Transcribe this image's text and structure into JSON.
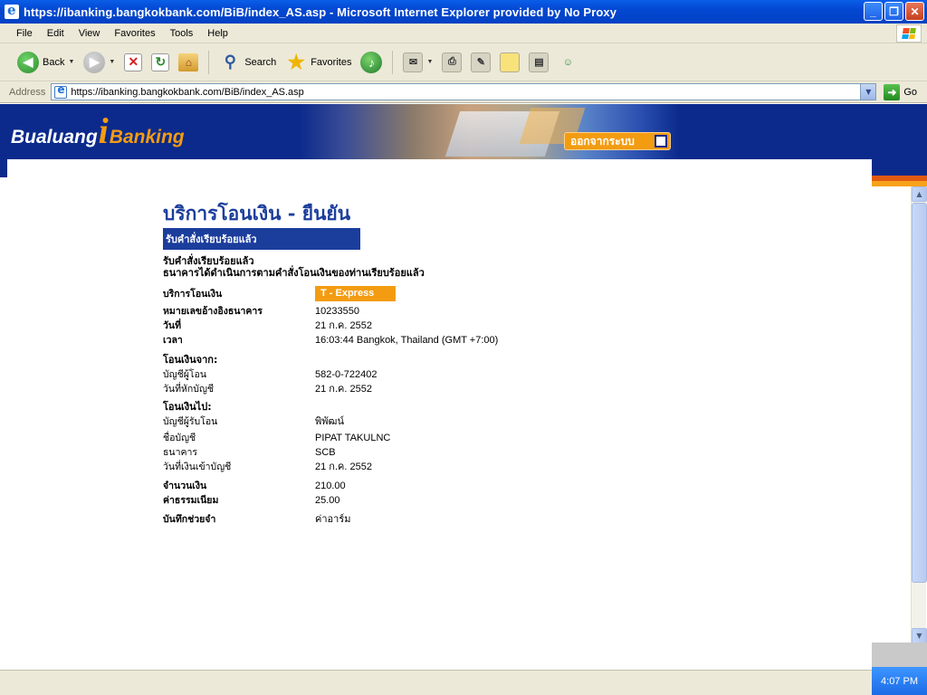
{
  "window": {
    "title": "https://ibanking.bangkokbank.com/BiB/index_AS.asp - Microsoft Internet Explorer provided by No Proxy"
  },
  "menu": [
    "File",
    "Edit",
    "View",
    "Favorites",
    "Tools",
    "Help"
  ],
  "toolbar": {
    "back_label": "Back",
    "search_label": "Search",
    "favorites_label": "Favorites"
  },
  "address": {
    "label": "Address",
    "url": "https://ibanking.bangkokbank.com/BiB/index_AS.asp",
    "go_label": "Go"
  },
  "banner": {
    "logo_part1": "Bualuang",
    "logo_part2": "i",
    "logo_part3": "Banking",
    "logout_label": "ออกจากระบบ"
  },
  "page": {
    "heading": "บริการโอนเงิน - ยืนยัน",
    "status": "รับคำสั่งเรียบร้อยแล้ว",
    "confirm_line1": "รับคำสั่งเรียบร้อยแล้ว",
    "confirm_line2": "ธนาคารได้ดำเนินการตามคำสั่งโอนเงินของท่านเรียบร้อยแล้ว",
    "service_label": "บริการโอนเงิน",
    "service_value": "T - Express",
    "ref_label": "หมายเลขอ้างอิงธนาคาร",
    "ref_value": "10233550",
    "date_label": "วันที่",
    "date_value": "21 ก.ค. 2552",
    "time_label": "เวลา",
    "time_value": "16:03:44 Bangkok, Thailand (GMT +7:00)",
    "from_heading": "โอนเงินจาก:",
    "from_account_label": "บัญชีผู้โอน",
    "from_account_value": "582-0-722402",
    "debit_date_label": "วันที่หักบัญชี",
    "debit_date_value": "21 ก.ค. 2552",
    "to_heading": "โอนเงินไป:",
    "to_account_label": "บัญชีผู้รับโอน",
    "to_account_value": "พิพัฒน์",
    "account_name_label": "ชื่อบัญชี",
    "account_name_value": "PIPAT TAKULNC",
    "bank_label": "ธนาคาร",
    "bank_value": "SCB",
    "credit_date_label": "วันที่เงินเข้าบัญชี",
    "credit_date_value": "21 ก.ค. 2552",
    "amount_label": "จำนวนเงิน",
    "amount_value": "210.00",
    "fee_label": "ค่าธรรมเนียม",
    "fee_value": "25.00",
    "memo_label": "บันทึกช่วยจำ",
    "memo_value": "ค่าอาร์ม"
  },
  "taskbar": {
    "clock": "4:07 PM"
  }
}
